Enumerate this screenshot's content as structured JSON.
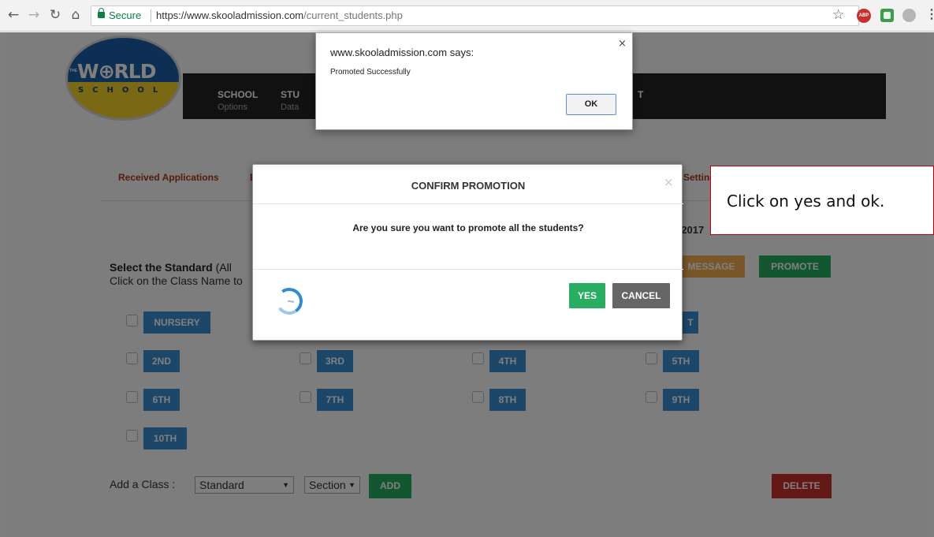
{
  "browser": {
    "secure_label": "Secure",
    "url_prefix": "https://www.skooladmission.com",
    "url_path": "/current_students.php",
    "abp_label": "ABP"
  },
  "logo": {
    "title": "W⊕RLD",
    "the": "THE",
    "subtitle": "SCHOOL"
  },
  "navbar": {
    "items": [
      {
        "main": "SCHOOL",
        "sub": "Options"
      },
      {
        "main": "STU",
        "sub": "Data"
      },
      {
        "main": "T",
        "sub": ""
      }
    ]
  },
  "subnav": {
    "received": "Received Applications",
    "partial_e": "E",
    "settings": "Setting"
  },
  "year_fragment": "-2017",
  "standard": {
    "heading": "Select the Standard",
    "heading_rest": " (All",
    "hint": "Click on the Class Name to"
  },
  "actions": {
    "message": "MESSAGE",
    "promote": "PROMOTE",
    "add": "ADD",
    "delete": "DELETE"
  },
  "classes": [
    {
      "label": "NURSERY"
    },
    {
      "label": "T"
    },
    {
      "label": "2ND"
    },
    {
      "label": "3RD"
    },
    {
      "label": "4TH"
    },
    {
      "label": "5TH"
    },
    {
      "label": "6TH"
    },
    {
      "label": "7TH"
    },
    {
      "label": "8TH"
    },
    {
      "label": "9TH"
    },
    {
      "label": "10TH"
    }
  ],
  "add_class": {
    "label": "Add a Class :",
    "standard_value": "Standard",
    "section_value": "Section"
  },
  "modal": {
    "title": "CONFIRM PROMOTION",
    "close": "×",
    "question": "Are you sure you want to promote all the students?",
    "yes": "YES",
    "cancel": "CANCEL"
  },
  "alert": {
    "title": "www.skooladmission.com says:",
    "message": "Promoted Successfully",
    "close": "×",
    "ok": "OK"
  },
  "callout": {
    "text": "Click on yes and ok."
  },
  "colors": {
    "promote_green": "#27ae60",
    "class_blue": "#3a8fd0",
    "delete_red": "#c9302c",
    "message_orange": "#f0ad4e",
    "callout_border": "#c00000"
  },
  "icons": [
    "back-icon",
    "forward-icon",
    "reload-icon",
    "home-icon",
    "lock-icon",
    "star-icon",
    "abp-extension-icon",
    "green-extension-icon",
    "gray-extension-icon",
    "menu-icon",
    "spinner-icon",
    "close-icon"
  ]
}
